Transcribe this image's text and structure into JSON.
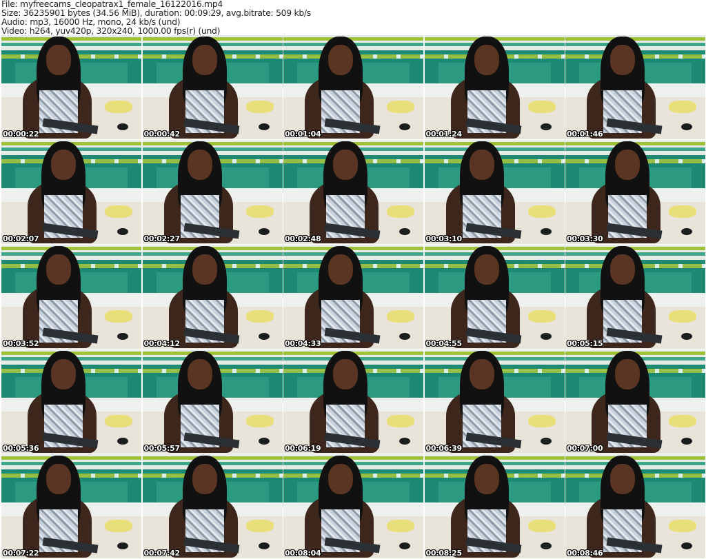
{
  "header": {
    "file": "File: myfreecams_cleopatrax1_female_16122016.mp4",
    "size": "Size: 36235901 bytes (34.56 MiB), duration: 00:09:29, avg.bitrate: 509 kb/s",
    "audio": "Audio: mp3, 16000 Hz, mono, 24 kb/s (und)",
    "video": "Video: h264, yuv420p, 320x240, 1000.00 fps(r) (und)"
  },
  "thumbnails": [
    {
      "timestamp": "00:00:22"
    },
    {
      "timestamp": "00:00:42"
    },
    {
      "timestamp": "00:01:04"
    },
    {
      "timestamp": "00:01:24"
    },
    {
      "timestamp": "00:01:46"
    },
    {
      "timestamp": "00:02:07"
    },
    {
      "timestamp": "00:02:27"
    },
    {
      "timestamp": "00:02:48"
    },
    {
      "timestamp": "00:03:10"
    },
    {
      "timestamp": "00:03:30"
    },
    {
      "timestamp": "00:03:52"
    },
    {
      "timestamp": "00:04:12"
    },
    {
      "timestamp": "00:04:33"
    },
    {
      "timestamp": "00:04:55"
    },
    {
      "timestamp": "00:05:15"
    },
    {
      "timestamp": "00:05:36"
    },
    {
      "timestamp": "00:05:57"
    },
    {
      "timestamp": "00:06:19"
    },
    {
      "timestamp": "00:06:39"
    },
    {
      "timestamp": "00:07:00"
    },
    {
      "timestamp": "00:07:22"
    },
    {
      "timestamp": "00:07:42"
    },
    {
      "timestamp": "00:08:04"
    },
    {
      "timestamp": "00:08:25"
    },
    {
      "timestamp": "00:08:46"
    }
  ]
}
